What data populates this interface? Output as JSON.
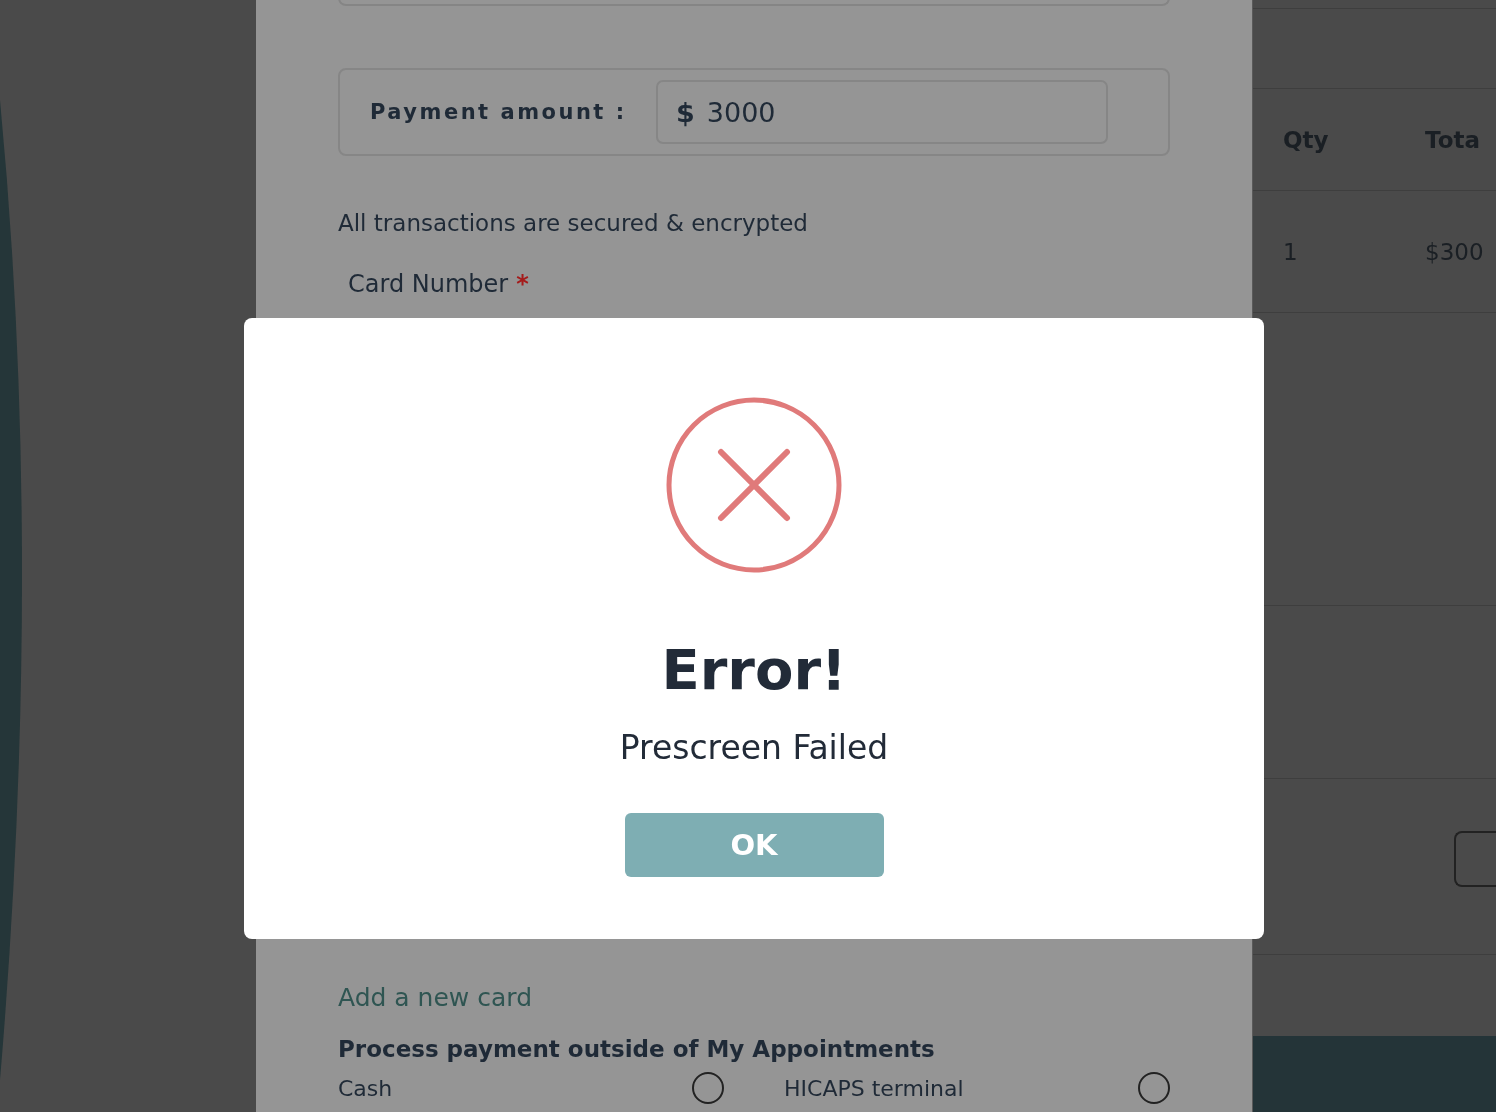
{
  "payment_form": {
    "payment_amount": {
      "label": "Payment amount :",
      "currency": "$",
      "value": "3000"
    },
    "security_note": "All transactions are secured & encrypted",
    "card_number": {
      "label": "Card Number",
      "required_mark": "*"
    },
    "add_card_link": "Add a new card",
    "outside_heading": "Process payment outside of My Appointments",
    "outside_options": [
      {
        "label": "Cash",
        "selected": false
      },
      {
        "label": "HICAPS terminal",
        "selected": false
      }
    ]
  },
  "summary_table": {
    "columns": [
      "Qty",
      "Tota"
    ],
    "rows": [
      [
        "1",
        "$300"
      ]
    ]
  },
  "dialog": {
    "title": "Error!",
    "message": "Prescreen Failed",
    "button": "OK"
  }
}
